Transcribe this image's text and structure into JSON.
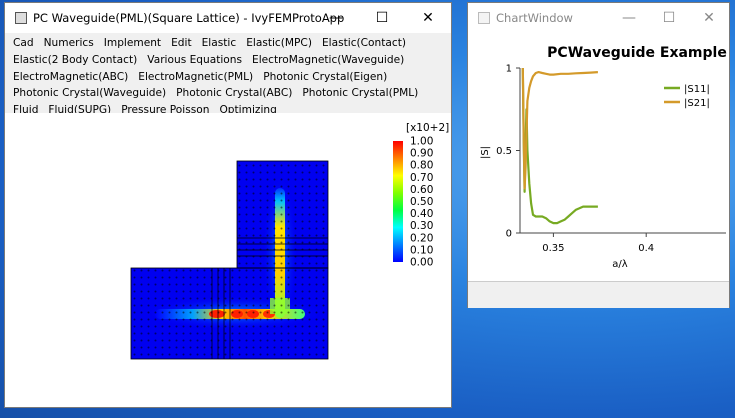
{
  "main_window": {
    "title": "PC Waveguide(PML)(Square Lattice) - IvyFEMProtoApp",
    "minimize_glyph": "—",
    "maximize_glyph": "☐",
    "close_glyph": "✕",
    "menu": [
      "Cad",
      "Numerics",
      "Implement",
      "Edit",
      "Elastic",
      "Elastic(MPC)",
      "Elastic(Contact)",
      "Elastic(2 Body Contact)",
      "Various Equations",
      "ElectroMagnetic(Waveguide)",
      "ElectroMagnetic(ABC)",
      "ElectroMagnetic(PML)",
      "Photonic Crystal(Eigen)",
      "Photonic Crystal(Waveguide)",
      "Photonic Crystal(ABC)",
      "Photonic Crystal(PML)",
      "Fluid",
      "Fluid(SUPG)",
      "Pressure Poisson",
      "Optimizing"
    ],
    "colorbar": {
      "multiplier": "[x10+2]",
      "ticks": [
        "1.00",
        "0.90",
        "0.80",
        "0.70",
        "0.60",
        "0.50",
        "0.40",
        "0.30",
        "0.20",
        "0.10",
        "0.00"
      ],
      "colors": [
        "#ff0000",
        "#ff8000",
        "#ffff00",
        "#80ff00",
        "#00ff40",
        "#00ffff",
        "#0080ff",
        "#0000ff"
      ]
    }
  },
  "chart_window": {
    "title": "ChartWindow",
    "minimize_glyph": "—",
    "maximize_glyph": "☐",
    "close_glyph": "✕"
  },
  "chart_data": {
    "type": "line",
    "title": "PCWaveguide Example",
    "xlabel": "a/λ",
    "ylabel": "|S|",
    "xlim": [
      0.332,
      0.443
    ],
    "ylim": [
      0,
      1
    ],
    "x_ticks": [
      "0.35",
      "0.4"
    ],
    "x_tick_values": [
      0.35,
      0.4
    ],
    "y_ticks": [
      "0",
      "0.5",
      "1"
    ],
    "y_tick_values": [
      0,
      0.5,
      1
    ],
    "legend_position": "top-right",
    "series": [
      {
        "name": "|S11|",
        "color": "#77aa22",
        "x": [
          0.3335,
          0.334,
          0.3345,
          0.335,
          0.3355,
          0.336,
          0.337,
          0.338,
          0.339,
          0.3405,
          0.342,
          0.344,
          0.346,
          0.348,
          0.35,
          0.352,
          0.354,
          0.356,
          0.358,
          0.36,
          0.362,
          0.364,
          0.366,
          0.368,
          0.37,
          0.372,
          0.374
        ],
        "y": [
          1.0,
          0.55,
          0.25,
          0.55,
          0.75,
          0.5,
          0.3,
          0.18,
          0.11,
          0.1,
          0.1,
          0.1,
          0.09,
          0.07,
          0.06,
          0.06,
          0.07,
          0.08,
          0.1,
          0.12,
          0.14,
          0.15,
          0.16,
          0.16,
          0.16,
          0.16,
          0.16
        ]
      },
      {
        "name": "|S21|",
        "color": "#d49a2a",
        "x": [
          0.3335,
          0.334,
          0.3345,
          0.335,
          0.3355,
          0.336,
          0.337,
          0.338,
          0.339,
          0.3405,
          0.342,
          0.344,
          0.346,
          0.348,
          0.35,
          0.354,
          0.358,
          0.362,
          0.366,
          0.37,
          0.374
        ],
        "y": [
          1.0,
          0.6,
          0.27,
          0.4,
          0.6,
          0.8,
          0.88,
          0.92,
          0.95,
          0.97,
          0.975,
          0.97,
          0.965,
          0.96,
          0.96,
          0.965,
          0.965,
          0.968,
          0.97,
          0.972,
          0.975
        ]
      }
    ]
  }
}
